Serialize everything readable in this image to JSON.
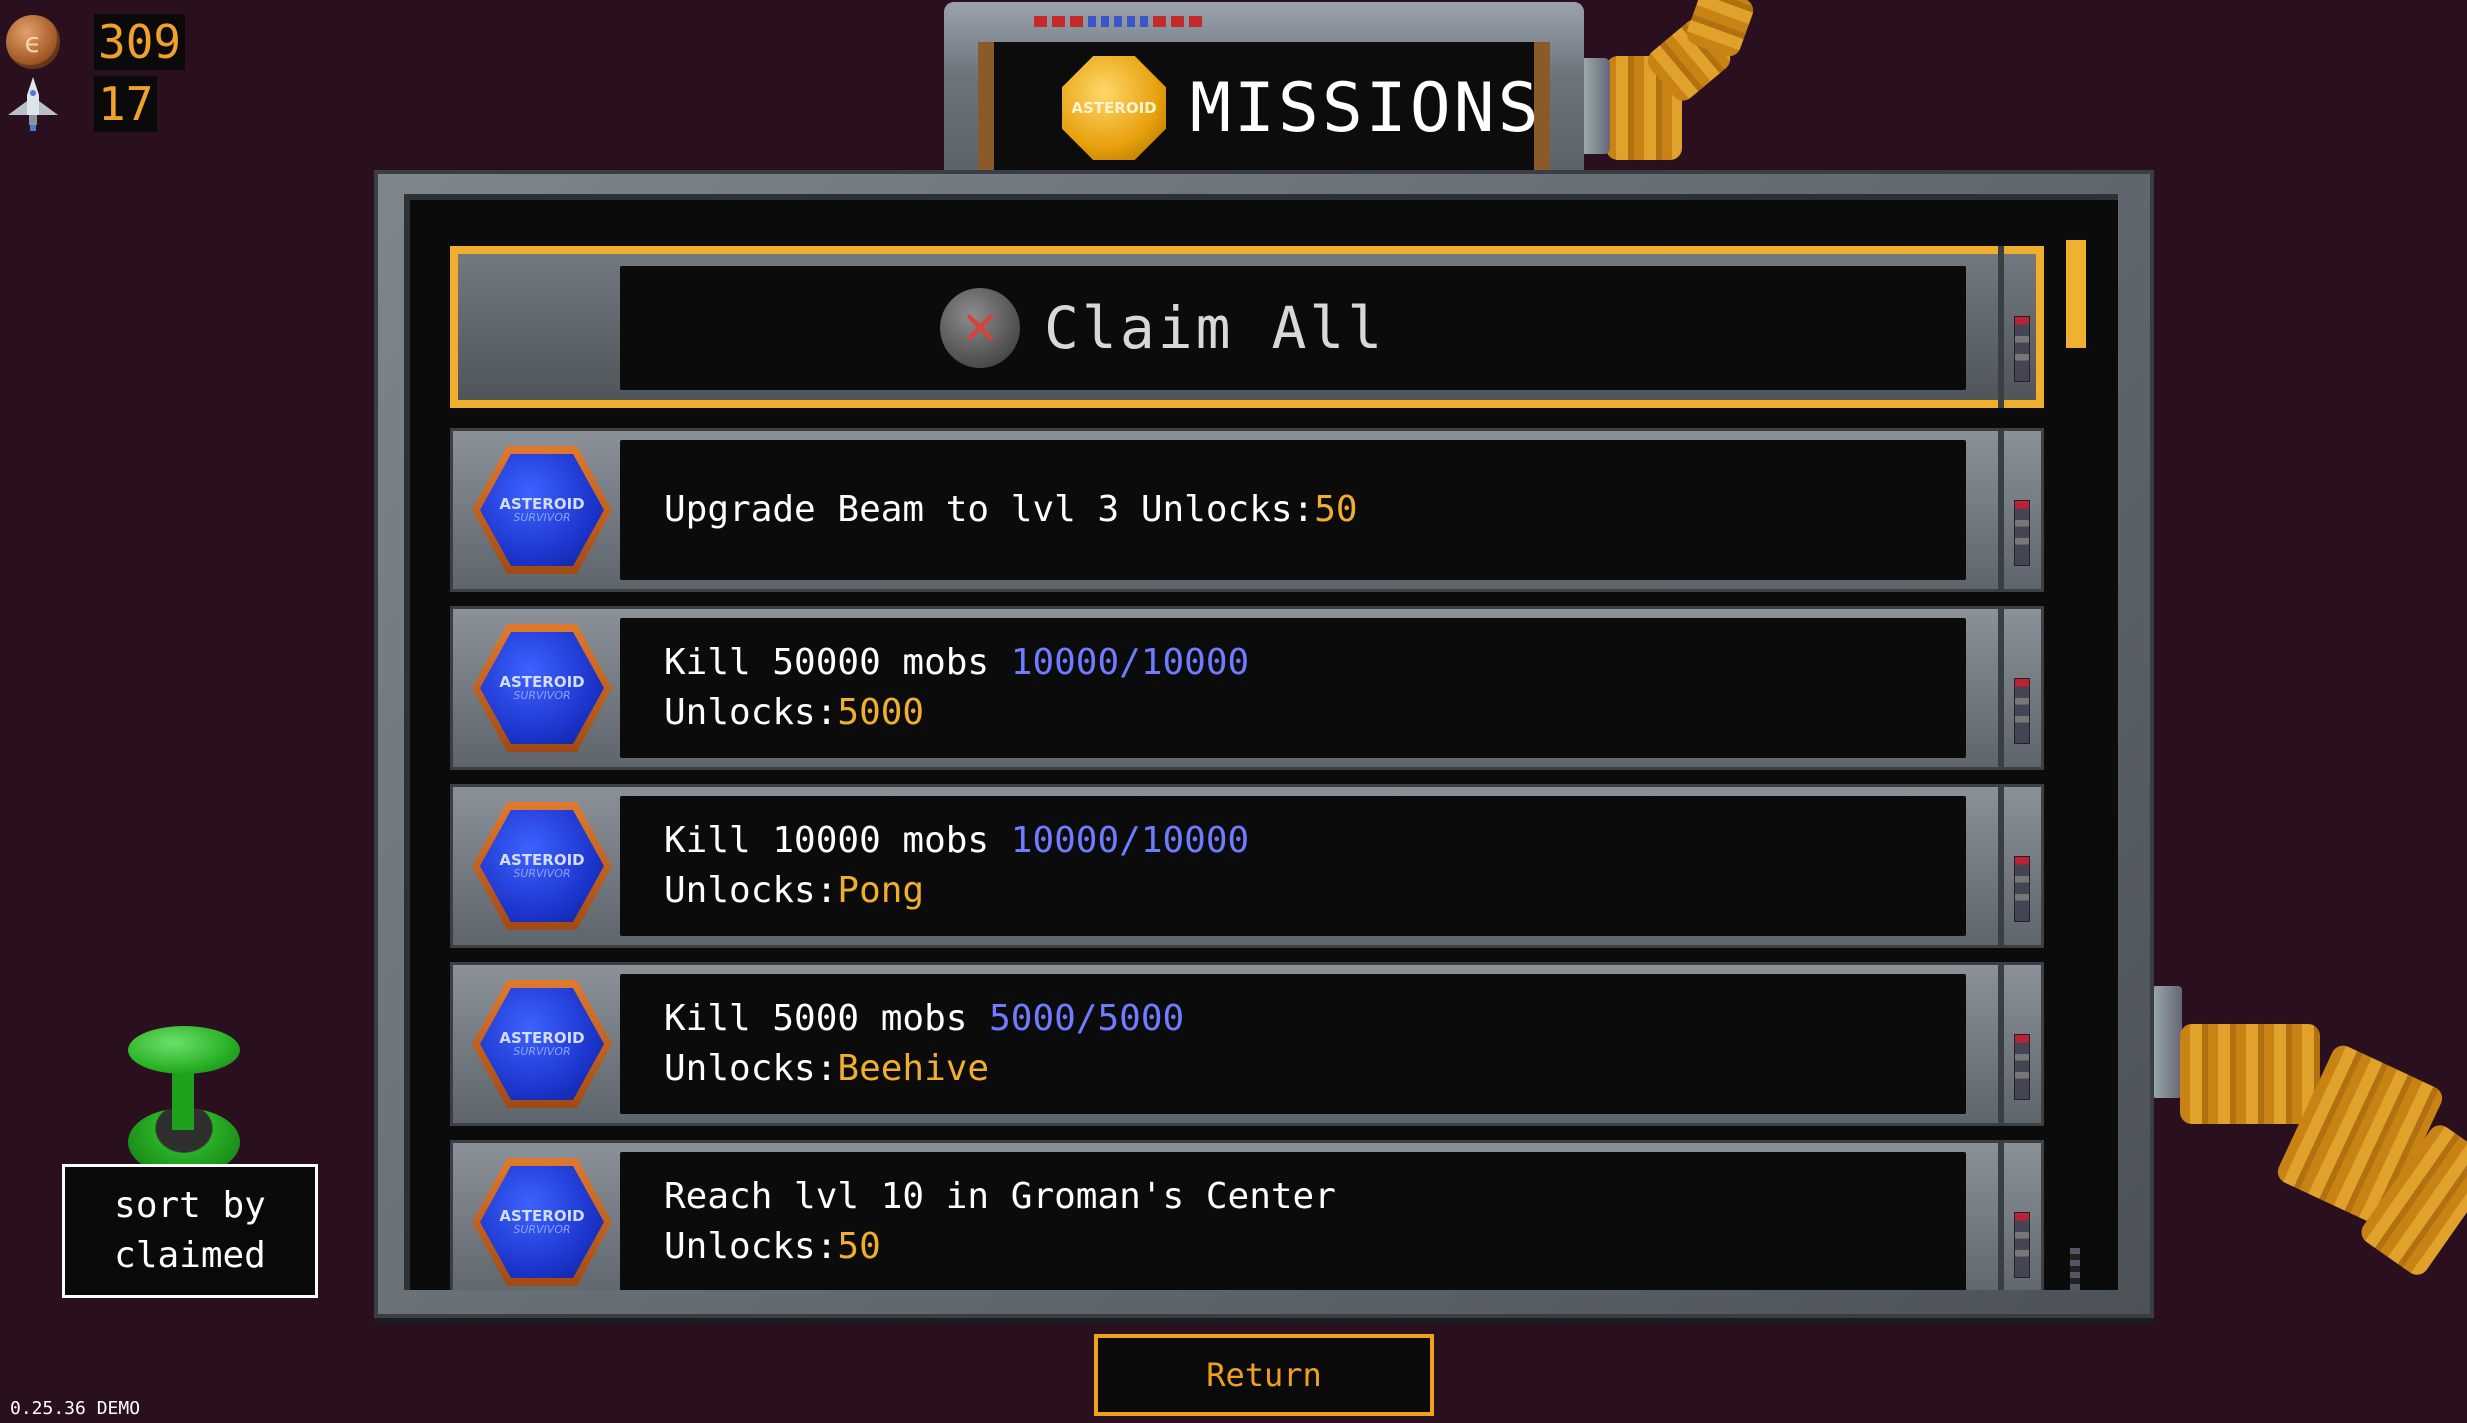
{
  "hud": {
    "coin_icon_letter": "ϵ",
    "coins": "309",
    "ships": "17"
  },
  "title": {
    "badge": "ASTEROID",
    "text": "MISSIONS"
  },
  "claim_all": {
    "label": "Claim All"
  },
  "mission_badge": {
    "top": "ASTEROID",
    "bottom": "SURVIVOR"
  },
  "missions": [
    {
      "line1": "Upgrade Beam to lvl 3 ",
      "progress": "",
      "unlocks_label": "Unlocks:",
      "unlocks_value": "50"
    },
    {
      "line1": "Kill 50000 mobs ",
      "progress": "10000/10000",
      "unlocks_label": "Unlocks:",
      "unlocks_value": "5000"
    },
    {
      "line1": "Kill 10000 mobs ",
      "progress": "10000/10000",
      "unlocks_label": "Unlocks:",
      "unlocks_value": "Pong"
    },
    {
      "line1": "Kill 5000 mobs ",
      "progress": "5000/5000",
      "unlocks_label": "Unlocks:",
      "unlocks_value": "Beehive"
    },
    {
      "line1": "Reach lvl 10 in Groman's Center",
      "progress": "",
      "unlocks_label": "Unlocks:",
      "unlocks_value": "50"
    }
  ],
  "sort": {
    "line1": "sort by",
    "line2": "claimed"
  },
  "return_label": "Return",
  "version": "0.25.36 DEMO",
  "colors": {
    "background": "#2a0f1f",
    "accent_orange": "#f0ae2e",
    "progress_blue": "#6f7cff",
    "joystick_green": "#29b126"
  }
}
